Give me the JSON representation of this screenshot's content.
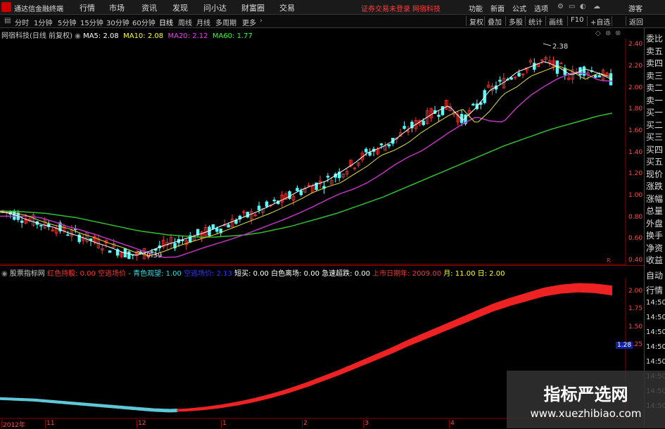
{
  "app": {
    "title": "通达信金融终端",
    "menus": [
      "行情",
      "市场",
      "资讯",
      "发现",
      "问小达",
      "财富圈",
      "交易"
    ],
    "warning": "证券交易未登录",
    "stock_name": "网宿科技",
    "right_menus": [
      "功能",
      "新面",
      "公式",
      "选项"
    ],
    "guest": "游客"
  },
  "toolbar": {
    "periods": [
      "分时",
      "1分钟",
      "5分钟",
      "15分钟",
      "30分钟",
      "60分钟",
      "日线",
      "周线",
      "月线",
      "多周期",
      "更多"
    ],
    "selected": "日线",
    "tools": [
      "复权",
      "叠加",
      "多股",
      "统计",
      "画线",
      "F10",
      "+自选",
      "返回"
    ]
  },
  "main_chart": {
    "caption": "网宿科技(日线 前复权)",
    "ma": [
      {
        "label": "MA5: 2.08",
        "color": "#ffffff"
      },
      {
        "label": "MA10: 2.08",
        "color": "#ffff33"
      },
      {
        "label": "MA20: 2.12",
        "color": "#ff33ff"
      },
      {
        "label": "MA60: 1.77",
        "color": "#33ff33"
      }
    ],
    "high_label": "2.38",
    "low_label": "0.39",
    "y_ticks": [
      "2.40",
      "2.20",
      "2.00",
      "1.80",
      "1.60",
      "1.40",
      "1.20",
      "1.00",
      "0.80",
      "0.60",
      "0.40"
    ],
    "marker": "R"
  },
  "indicator": {
    "name": "股票指标网",
    "items": [
      {
        "label": "红色持股: 0.00",
        "color": "#ff3333"
      },
      {
        "label": "空逃场价",
        "color": "#ff3333"
      },
      {
        "label": "- 青色观望: 1.00",
        "color": "#33dddd"
      },
      {
        "label": "空逃场价: 2.13",
        "color": "#3333ff"
      },
      {
        "label": "短买: 0.00",
        "color": "#ffffff"
      },
      {
        "label": "白色离场: 0.00",
        "color": "#ffffff"
      },
      {
        "label": "急速超跌: 0.00",
        "color": "#ffffff"
      },
      {
        "label": "上市日期年: 2009.00",
        "color": "#ff3333"
      },
      {
        "label": "月: 11.00",
        "color": "#ffff33"
      },
      {
        "label": "日: 2.00",
        "color": "#ffff33"
      }
    ],
    "y_ticks": [
      "2.00",
      "1.75",
      "1.50",
      "1.25"
    ],
    "current_value": "1.28"
  },
  "x_ticks": [
    "2012年",
    "11",
    "12",
    "1",
    "2",
    "3",
    "4"
  ],
  "quote_panel": [
    "委比",
    "卖五",
    "卖四",
    "卖三",
    "卖二",
    "卖一",
    "买一",
    "买二",
    "买三",
    "买四",
    "买五",
    "现价",
    "涨跌",
    "涨幅",
    "总量",
    "外盘",
    "换手",
    "净资",
    "收益"
  ],
  "quote_panel_lower": [
    "自动",
    "行情",
    "14:50",
    "14:50",
    "14:50",
    "14:50",
    "14:50",
    "14:50",
    "14:50",
    "14:50"
  ],
  "watermark": {
    "title": "指标严选网",
    "url": "www.xuezhibiao.com"
  },
  "chart_data": {
    "type": "line",
    "title": "网宿科技(日线 前复权)",
    "ylim": [
      0.36,
      2.46
    ],
    "series": [
      {
        "name": "MA5",
        "values": [
          0.86,
          0.83,
          0.78,
          0.74,
          0.71,
          0.66,
          0.62,
          0.57,
          0.53,
          0.48,
          0.45,
          0.49,
          0.54,
          0.58,
          0.62,
          0.66,
          0.71,
          0.76,
          0.81,
          0.86,
          0.92,
          0.98,
          1.05,
          1.1,
          1.14,
          1.22,
          1.3,
          1.4,
          1.45,
          1.52,
          1.62,
          1.7,
          1.78,
          1.84,
          1.7,
          1.82,
          1.98,
          2.05,
          2.15,
          2.2,
          2.25,
          2.2,
          2.12,
          2.18,
          2.14,
          2.08
        ]
      },
      {
        "name": "MA60",
        "values": [
          0.86,
          0.86,
          0.85,
          0.84,
          0.82,
          0.8,
          0.77,
          0.74,
          0.71,
          0.68,
          0.66,
          0.64,
          0.63,
          0.62,
          0.62,
          0.63,
          0.64,
          0.66,
          0.69,
          0.72,
          0.76,
          0.8,
          0.84,
          0.89,
          0.94,
          0.99,
          1.05,
          1.11,
          1.17,
          1.23,
          1.29,
          1.35,
          1.41,
          1.47,
          1.52,
          1.57,
          1.62,
          1.66,
          1.7,
          1.74,
          1.77
        ]
      },
      {
        "name": "indicator",
        "values": [
          0.5,
          0.49,
          0.48,
          0.46,
          0.44,
          0.42,
          0.4,
          0.38,
          0.36,
          0.34,
          0.33,
          0.34,
          0.36,
          0.39,
          0.43,
          0.48,
          0.54,
          0.61,
          0.69,
          0.78,
          0.87,
          0.97,
          1.07,
          1.17,
          1.28,
          1.38,
          1.48,
          1.58,
          1.68,
          1.78,
          1.86,
          1.93,
          2.0,
          2.04,
          2.06,
          2.05,
          2.02
        ]
      }
    ]
  }
}
